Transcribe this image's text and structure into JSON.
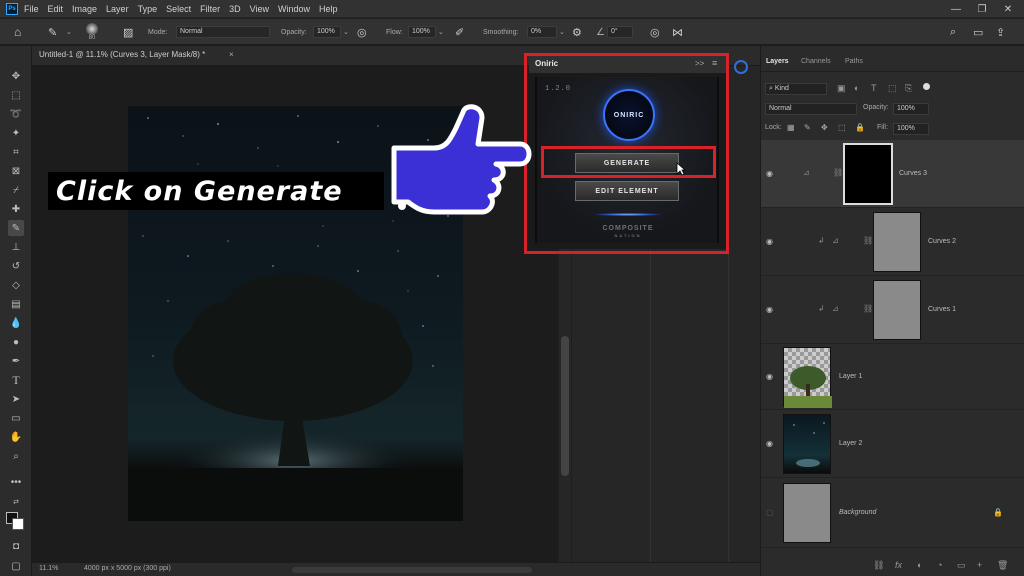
{
  "menu": {
    "app_icon": "Ps",
    "items": [
      "File",
      "Edit",
      "Image",
      "Layer",
      "Type",
      "Select",
      "Filter",
      "3D",
      "View",
      "Window",
      "Help"
    ],
    "window_controls": [
      "—",
      "❐",
      "✕"
    ]
  },
  "options": {
    "brush_size": "80",
    "mode_label": "Mode:",
    "mode_value": "Normal",
    "opacity_label": "Opacity:",
    "opacity_value": "100%",
    "flow_label": "Flow:",
    "flow_value": "100%",
    "smoothing_label": "Smoothing:",
    "smoothing_value": "0%",
    "angle_value": "0°"
  },
  "document": {
    "tab_title": "Untitled-1 @ 11.1% (Curves 3, Layer Mask/8) *",
    "tab_close": "×"
  },
  "status": {
    "zoom": "11.1%",
    "doc_info": "4000 px x 5000 px (300 ppi)"
  },
  "oniric": {
    "title": "Oniric",
    "header_icons": [
      ">>",
      "≡"
    ],
    "version": "1.2.0",
    "logo_text": "ONIRIC",
    "generate_label": "GENERATE",
    "edit_label": "EDIT ELEMENT",
    "brand": "COMPOSITE",
    "brand_sub": "NATION"
  },
  "callout": {
    "text": "Click on Generate",
    "accent": "#d8222a",
    "hand_color": "#3b2fd6"
  },
  "layers_panel": {
    "tabs": [
      "Layers",
      "Channels",
      "Paths"
    ],
    "kind_label": "Kind",
    "blend_mode": "Normal",
    "opacity_label": "Opacity:",
    "opacity_value": "100%",
    "lock_label": "Lock:",
    "fill_label": "Fill:",
    "fill_value": "100%",
    "layers": [
      {
        "name": "Curves 3"
      },
      {
        "name": "Curves 2"
      },
      {
        "name": "Curves 1"
      },
      {
        "name": "Layer 1"
      },
      {
        "name": "Layer 2"
      },
      {
        "name": "Background"
      }
    ],
    "footer_icons": [
      "⛓",
      "fx",
      "◐",
      "◔",
      "▭",
      "+",
      "🗑"
    ]
  }
}
